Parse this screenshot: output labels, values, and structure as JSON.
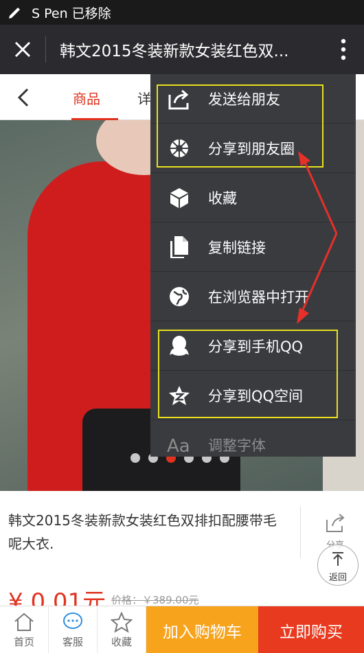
{
  "status_bar": {
    "text": "S Pen 已移除"
  },
  "title_bar": {
    "title": "韩文2015冬装新款女装红色双..."
  },
  "tabs": [
    {
      "label": "商品"
    },
    {
      "label": "详"
    }
  ],
  "carousel": {
    "total": 6,
    "active_index": 2
  },
  "product": {
    "name": "韩文2015冬装新款女装红色双排扣配腰带毛呢大衣.",
    "share_label": "分享",
    "price": "¥ 0.01元",
    "original_price": "价格：￥389.00元"
  },
  "back_to_top": {
    "label": "返回"
  },
  "bottom_bar": {
    "home": "首页",
    "service": "客服",
    "favorite": "收藏",
    "add_to_cart": "加入购物车",
    "buy_now": "立即购买"
  },
  "menu": {
    "items": [
      {
        "label": "发送给朋友",
        "icon": "send-icon"
      },
      {
        "label": "分享到朋友圈",
        "icon": "moments-icon"
      },
      {
        "label": "收藏",
        "icon": "cube-icon"
      },
      {
        "label": "复制链接",
        "icon": "copy-icon"
      },
      {
        "label": "在浏览器中打开",
        "icon": "globe-icon"
      },
      {
        "label": "分享到手机QQ",
        "icon": "qq-icon"
      },
      {
        "label": "分享到QQ空间",
        "icon": "qzone-icon"
      },
      {
        "label": "调整字体",
        "icon": "font-icon"
      }
    ]
  },
  "colors": {
    "accent": "#e0321e",
    "highlight": "#e7e11f",
    "cart": "#f7a31c",
    "buy": "#e83a1f"
  }
}
